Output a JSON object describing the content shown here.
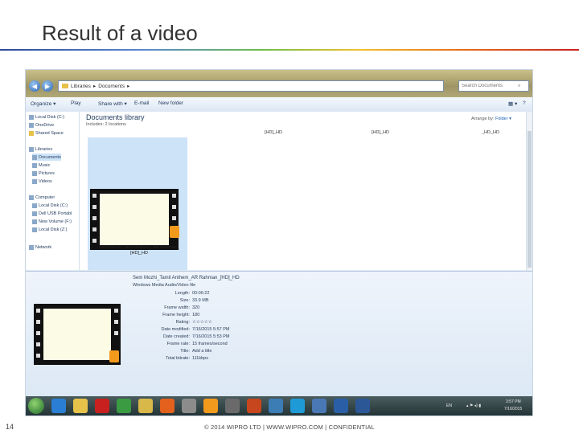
{
  "slide": {
    "title": "Result of a video",
    "page_number": "14",
    "footer": "© 2014 WIPRO LTD | WWW.WIPRO.COM | CONFIDENTIAL",
    "accent_colors": [
      "#2e4a9a",
      "#6abf4b",
      "#f2c12e",
      "#e8761e",
      "#c9221f"
    ]
  },
  "explorer": {
    "address": {
      "parts": [
        "Libraries",
        "Documents"
      ]
    },
    "search": {
      "placeholder": "Search Documents"
    },
    "toolbar": {
      "organize": "Organize ▾",
      "play": "Play",
      "share": "Share with ▾",
      "email": "E-mail",
      "new_folder": "New folder"
    },
    "sidebar": {
      "items": [
        {
          "label": "Local Disk (C:)",
          "icon": "drive-icon"
        },
        {
          "label": "OneDrive",
          "icon": "cloud-icon"
        },
        {
          "label": "Shared Space",
          "icon": "folder-icon"
        },
        {
          "label": "Libraries",
          "icon": "library-icon"
        },
        {
          "label": "Documents",
          "icon": "documents-icon"
        },
        {
          "label": "Music",
          "icon": "music-icon"
        },
        {
          "label": "Pictures",
          "icon": "pictures-icon"
        },
        {
          "label": "Videos",
          "icon": "videos-icon"
        },
        {
          "label": "Computer",
          "icon": "computer-icon"
        },
        {
          "label": "Local Disk (C:)",
          "icon": "drive-icon"
        },
        {
          "label": "Dell USB Portabl",
          "icon": "drive-icon"
        },
        {
          "label": "New Volume (F:)",
          "icon": "drive-icon"
        },
        {
          "label": "Local Disk (Z:)",
          "icon": "drive-icon"
        },
        {
          "label": "Network",
          "icon": "network-icon"
        }
      ]
    },
    "library": {
      "title": "Documents library",
      "subtitle": "Includes: 2 locations",
      "arrange_label": "Arrange by:",
      "arrange_value": "Folder ▾",
      "column_headers": [
        "[HD]_HD",
        "[HD]_HD",
        "_HD_HD"
      ]
    },
    "file": {
      "name_line1": "Sem Mozhi_Tamil Anthem_AR Rahman_",
      "name_line2": "[HD]_HD"
    },
    "details": {
      "filename": "Sem Mozhi_Tamil Anthem_AR Rahman_[HD]_HD",
      "type": "Windows Media Audio/Video file",
      "rows": [
        {
          "label": "Length:",
          "value": "00:06:22"
        },
        {
          "label": "Size:",
          "value": "33.9 MB"
        },
        {
          "label": "Frame width:",
          "value": "320"
        },
        {
          "label": "Frame height:",
          "value": "180"
        },
        {
          "label": "Rating:",
          "value": "☆☆☆☆☆"
        },
        {
          "label": "Date modified:",
          "value": "7/16/2015 5:57 PM"
        },
        {
          "label": "Date created:",
          "value": "7/16/2015 5:53 PM"
        },
        {
          "label": "Frame rate:",
          "value": "15 frames/second"
        },
        {
          "label": "Title:",
          "value": "Add a title"
        },
        {
          "label": "Total bitrate:",
          "value": "111kbps"
        }
      ]
    },
    "taskbar": {
      "apps": [
        "ie-icon",
        "folder-icon",
        "opera-icon",
        "chrome-icon",
        "explorer-icon",
        "firefox-icon",
        "app-icon",
        "vlc-icon",
        "app-icon",
        "powerpoint-icon",
        "app-icon",
        "skype-icon",
        "app-icon",
        "outlook-icon",
        "word-icon"
      ],
      "app_colors": [
        "#2a7fd4",
        "#e7c24a",
        "#c8201f",
        "#3a9b42",
        "#d9b84a",
        "#e3611c",
        "#8c8c8c",
        "#f39a1d",
        "#6a6a6a",
        "#c8461d",
        "#3c7db5",
        "#1e9ad6",
        "#4a78b5",
        "#2a5fa8",
        "#2b5797"
      ],
      "lang": "EN",
      "time": "3:57 PM",
      "date": "7/16/2015"
    }
  }
}
